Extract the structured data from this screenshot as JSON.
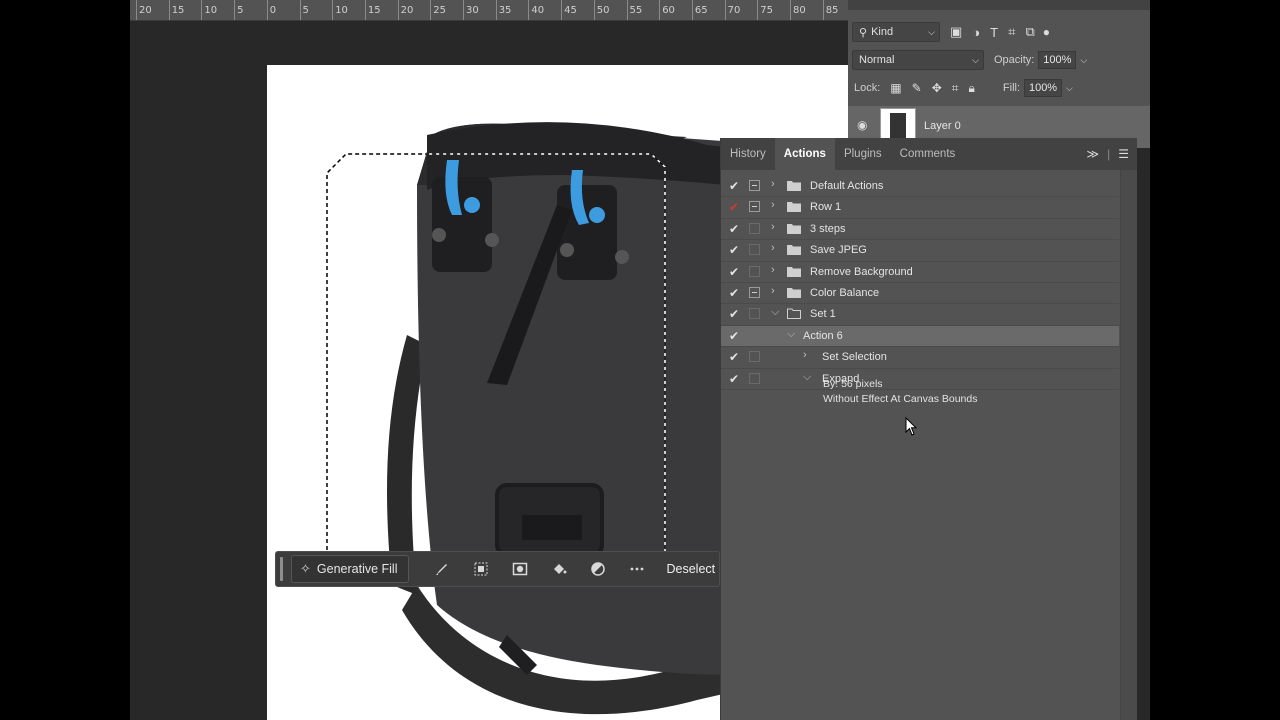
{
  "ruler": {
    "labels": [
      "20",
      "15",
      "10",
      "5",
      "0",
      "5",
      "10",
      "15",
      "20",
      "25",
      "30",
      "35",
      "40",
      "45",
      "50",
      "55",
      "60",
      "65",
      "70",
      "75",
      "80",
      "85"
    ]
  },
  "taskbar": {
    "generative_fill_label": "Generative Fill",
    "deselect_label": "Deselect",
    "icons": [
      "brush-icon",
      "select-subject-icon",
      "mask-icon",
      "paint-bucket-icon",
      "adjustment-icon",
      "more-icon"
    ]
  },
  "layers_panel": {
    "kind_label": "Kind",
    "blend_mode": "Normal",
    "opacity_label": "Opacity:",
    "opacity_value": "100%",
    "lock_label": "Lock:",
    "fill_label": "Fill:",
    "fill_value": "100%",
    "layer_name": "Layer 0"
  },
  "actions_panel": {
    "tabs": [
      "History",
      "Actions",
      "Plugins",
      "Comments"
    ],
    "active_tab": "Actions",
    "rows": [
      {
        "label": "Default Actions",
        "check": true,
        "dialog": true,
        "level": 0,
        "expanded": false,
        "type": "set"
      },
      {
        "label": "Row 1",
        "check": true,
        "check_red": true,
        "dialog": true,
        "level": 0,
        "expanded": false,
        "type": "set"
      },
      {
        "label": "3 steps",
        "check": true,
        "dialog": false,
        "level": 0,
        "expanded": false,
        "type": "set"
      },
      {
        "label": "Save JPEG",
        "check": true,
        "dialog": false,
        "level": 0,
        "expanded": false,
        "type": "set"
      },
      {
        "label": "Remove Background",
        "check": true,
        "dialog": false,
        "level": 0,
        "expanded": false,
        "type": "set"
      },
      {
        "label": "Color Balance",
        "check": true,
        "dialog": true,
        "level": 0,
        "expanded": false,
        "type": "set"
      },
      {
        "label": "Set 1",
        "check": true,
        "dialog": false,
        "level": 0,
        "expanded": true,
        "type": "set"
      },
      {
        "label": "Action 6",
        "check": true,
        "dialog": false,
        "level": 1,
        "expanded": true,
        "type": "action",
        "selected": true
      },
      {
        "label": "Set Selection",
        "check": true,
        "dialog": false,
        "level": 2,
        "expanded": false,
        "type": "step"
      },
      {
        "label": "Expand",
        "check": true,
        "dialog": false,
        "level": 2,
        "expanded": true,
        "type": "step"
      }
    ],
    "expand_details": [
      "By: 56 pixels",
      "Without Effect At Canvas Bounds"
    ]
  },
  "colors": {
    "accent_blue": "#3d9be0",
    "check_red": "#d23a2f"
  }
}
